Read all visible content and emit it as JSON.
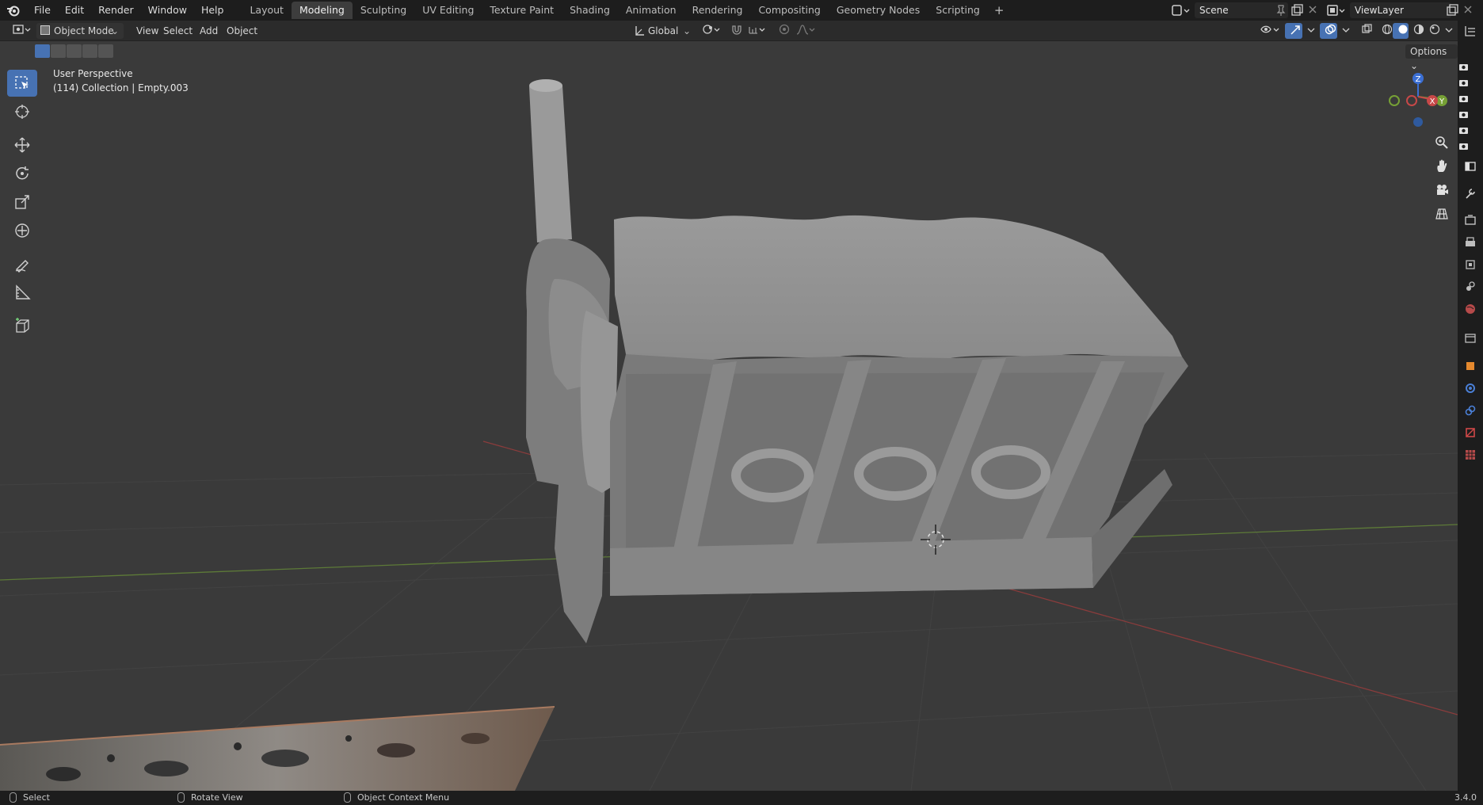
{
  "menu": [
    "File",
    "Edit",
    "Render",
    "Window",
    "Help"
  ],
  "workspaces": [
    "Layout",
    "Modeling",
    "Sculpting",
    "UV Editing",
    "Texture Paint",
    "Shading",
    "Animation",
    "Rendering",
    "Compositing",
    "Geometry Nodes",
    "Scripting"
  ],
  "active_workspace": "Modeling",
  "scene_name": "Scene",
  "view_layer": "ViewLayer",
  "header": {
    "mode": "Object Mode",
    "view": "View",
    "select": "Select",
    "add": "Add",
    "object": "Object",
    "orientation": "Global",
    "options": "Options"
  },
  "viewport": {
    "perspective": "User Perspective",
    "collection": "(114) Collection | Empty.003"
  },
  "gizmo": {
    "z": "Z",
    "x": "X",
    "y": "Y"
  },
  "status": {
    "select": "Select",
    "rotate": "Rotate View",
    "context": "Object Context Menu",
    "version": "3.4.0"
  },
  "colors": {
    "accent": "#4772b3",
    "axis_x": "#c74848",
    "axis_y": "#76a035",
    "axis_z": "#3b6fd4"
  }
}
